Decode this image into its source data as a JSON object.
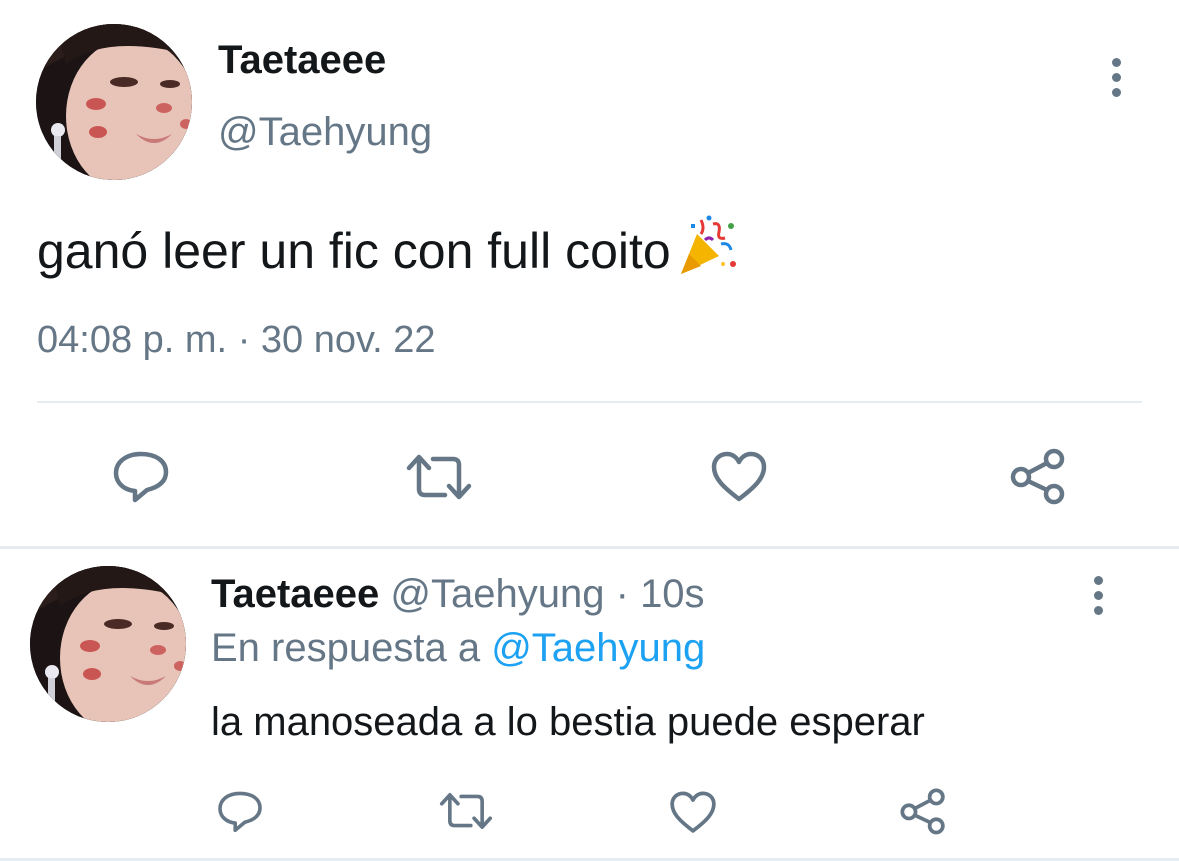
{
  "main_tweet": {
    "display_name": "Taetaeee",
    "handle": "@Taehyung",
    "text": "ganó leer un fic con full coito",
    "emoji": "party-popper-emoji",
    "time": "04:08 p. m.",
    "separator": "·",
    "date": "30 nov. 22"
  },
  "reply_tweet": {
    "display_name": "Taetaeee",
    "handle": "@Taehyung",
    "separator": "·",
    "time": "10s",
    "reply_prefix": "En respuesta a",
    "reply_to": "@Taehyung",
    "text": "la manoseada a lo bestia puede esperar"
  },
  "actions": [
    "reply-icon",
    "retweet-icon",
    "like-icon",
    "share-icon"
  ],
  "colors": {
    "text": "#14171a",
    "secondary": "#657786",
    "link": "#1da1f2",
    "divider": "#e6ecf0",
    "icon": "#657786"
  }
}
